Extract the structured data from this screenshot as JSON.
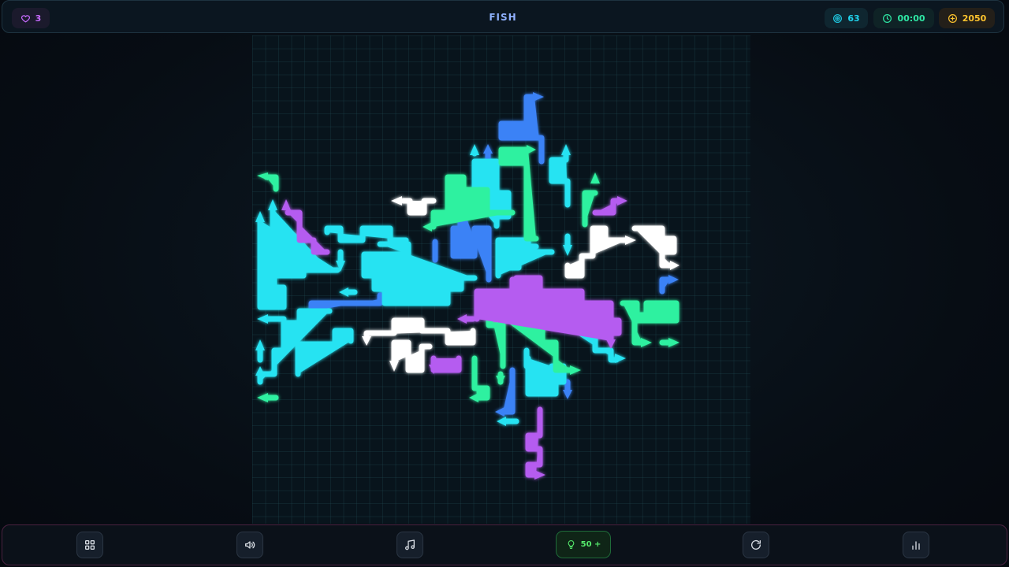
{
  "header": {
    "lives": "3",
    "level_name": "FISH",
    "moves": "63",
    "timer": "00:00",
    "coins": "2050"
  },
  "icons": {
    "lives": "heart-icon",
    "moves": "target-icon",
    "timer": "clock-icon",
    "coins": "coin-plus-icon",
    "menu": "grid-icon",
    "sound": "speaker-icon",
    "music": "music-note-icon",
    "hint": "lightbulb-icon",
    "restart": "restart-icon",
    "stats": "bar-chart-icon"
  },
  "hint": {
    "label": "50 +"
  },
  "colors": {
    "cyan": "#28e3f2",
    "green": "#2ff1a0",
    "blue": "#3b82f6",
    "purple": "#b55cf0",
    "white": "#ffffff",
    "lives": "#c86bff",
    "moves": "#20d4ee",
    "timer": "#2ee6a4",
    "coins": "#ffc42e",
    "hint": "#55ea6c"
  }
}
